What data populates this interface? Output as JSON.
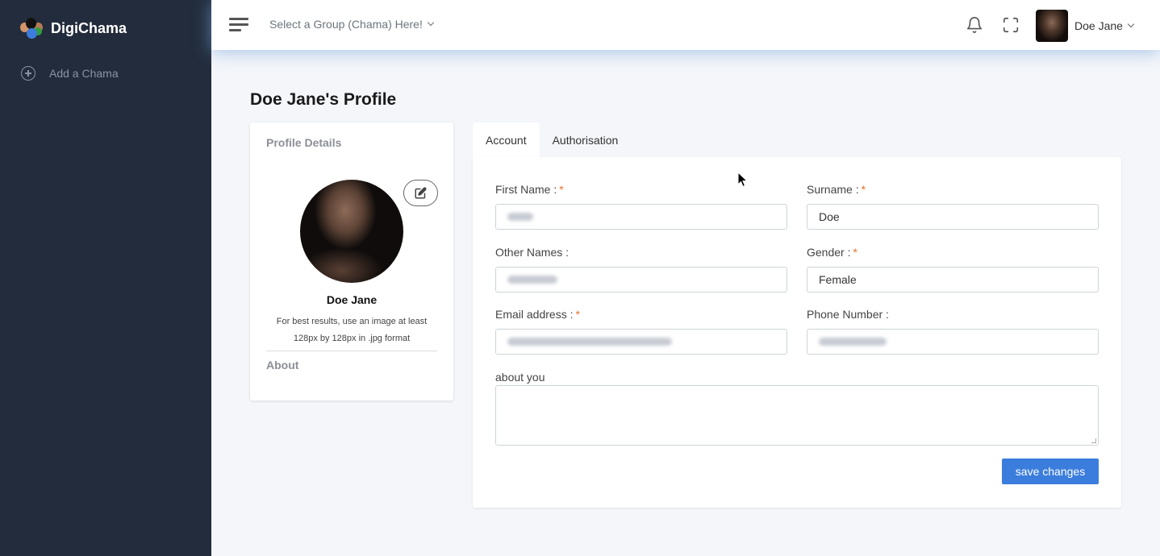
{
  "sidebar": {
    "brand_name": "DigiChama",
    "items": [
      {
        "label": "Add a Chama",
        "icon": "plus-circle-icon"
      }
    ]
  },
  "topbar": {
    "menu_icon": "hamburger-icon",
    "group_select": "Select a Group (Chama) Here!",
    "notification_icon": "bell-icon",
    "fullscreen_icon": "fullscreen-icon",
    "user_name": "Doe Jane"
  },
  "page": {
    "title": "Doe Jane's Profile"
  },
  "profile_card": {
    "header": "Profile Details",
    "name": "Doe Jane",
    "hint_line1": "For best results, use an image at least",
    "hint_line2": "128px by 128px in .jpg format",
    "about_header": "About"
  },
  "tabs": [
    {
      "label": "Account",
      "active": true
    },
    {
      "label": "Authorisation",
      "active": false
    }
  ],
  "form": {
    "first_name": {
      "label": "First Name :",
      "required": "*",
      "value": "",
      "redacted": true
    },
    "surname": {
      "label": "Surname :",
      "required": "*",
      "value": "Doe"
    },
    "other_names": {
      "label": "Other Names :",
      "value": "",
      "redacted": true
    },
    "gender": {
      "label": "Gender :",
      "required": "*",
      "value": "Female"
    },
    "email": {
      "label": "Email address :",
      "required": "*",
      "value": "",
      "redacted": true
    },
    "phone": {
      "label": "Phone Number :",
      "value": "",
      "redacted": true
    },
    "about": {
      "label": "about you",
      "value": ""
    },
    "save_label": "save changes"
  },
  "colors": {
    "sidebar_bg": "#222c3c",
    "primary": "#3b7ddd",
    "required": "#e8702a",
    "page_bg": "#f4f6fa"
  }
}
